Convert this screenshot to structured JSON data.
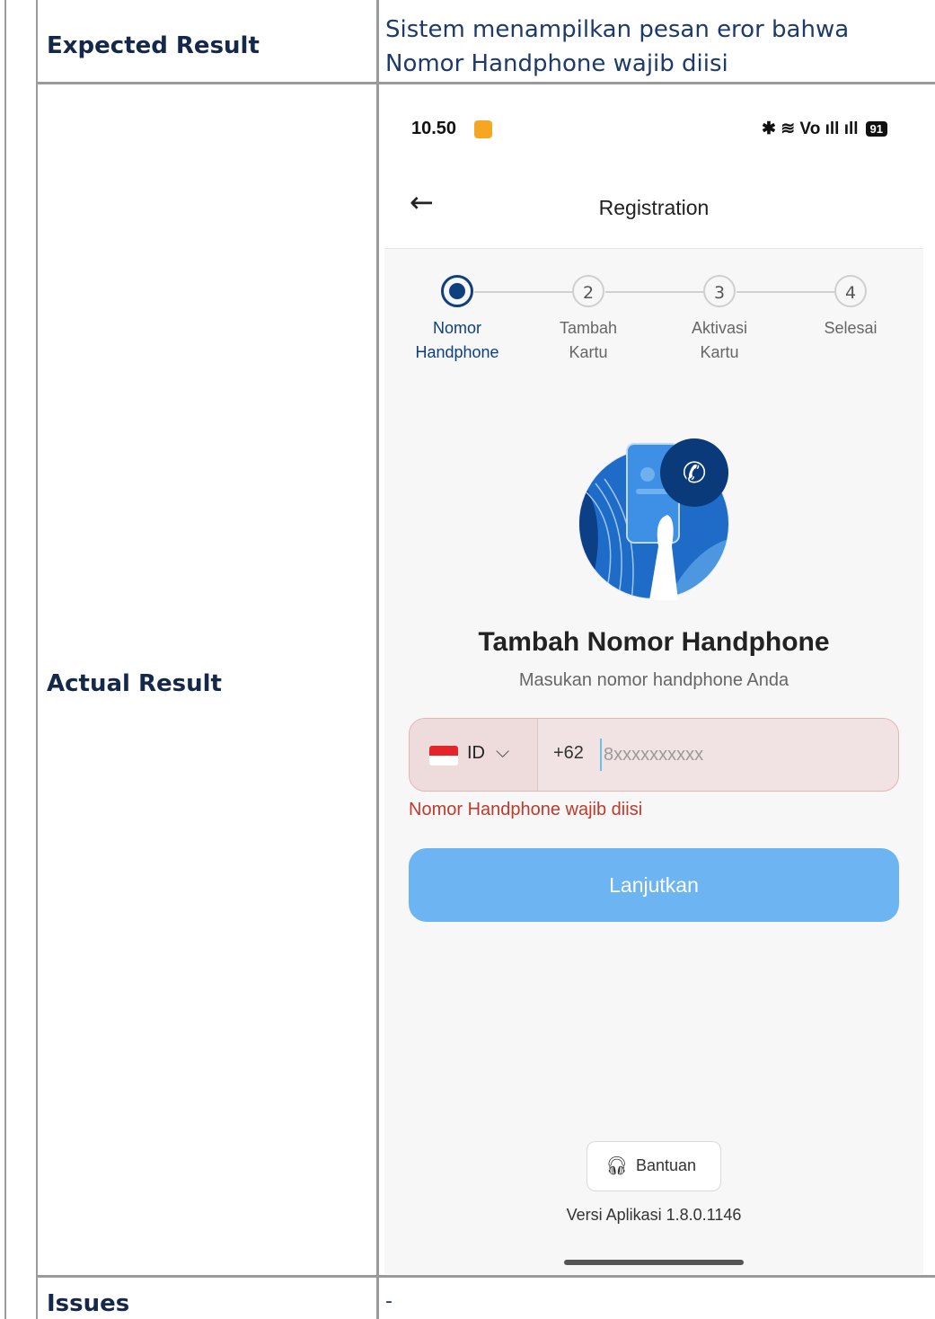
{
  "table": {
    "expected_label": "Expected Result",
    "expected_value": "Sistem menampilkan pesan eror bahwa Nomor Handphone wajib diisi",
    "actual_label": "Actual Result",
    "issues_label": "Issues",
    "issues_value": "-"
  },
  "phone": {
    "status": {
      "time": "10.50",
      "icons": "✱ ≋ Vo ıll ıll",
      "battery": "91"
    },
    "appbar": {
      "title": "Registration"
    },
    "stepper": [
      {
        "number": "",
        "label_line1": "Nomor",
        "label_line2": "Handphone",
        "active": true
      },
      {
        "number": "2",
        "label_line1": "Tambah",
        "label_line2": "Kartu",
        "active": false
      },
      {
        "number": "3",
        "label_line1": "Aktivasi",
        "label_line2": "Kartu",
        "active": false
      },
      {
        "number": "4",
        "label_line1": "Selesai",
        "label_line2": "",
        "active": false
      }
    ],
    "title": "Tambah Nomor Handphone",
    "subtitle": "Masukan nomor handphone Anda",
    "country_code": "ID",
    "prefix": "+62",
    "phone_placeholder": "8xxxxxxxxxx",
    "phone_value": "",
    "error": "Nomor Handphone wajib diisi",
    "continue_button": "Lanjutkan",
    "help_button": "Bantuan",
    "version": "Versi Aplikasi  1.8.0.1146"
  },
  "colors": {
    "primary": "#0e3f7f",
    "button": "#6db5f2",
    "error": "#c0392b",
    "input_error_bg": "#f1e3e3"
  }
}
